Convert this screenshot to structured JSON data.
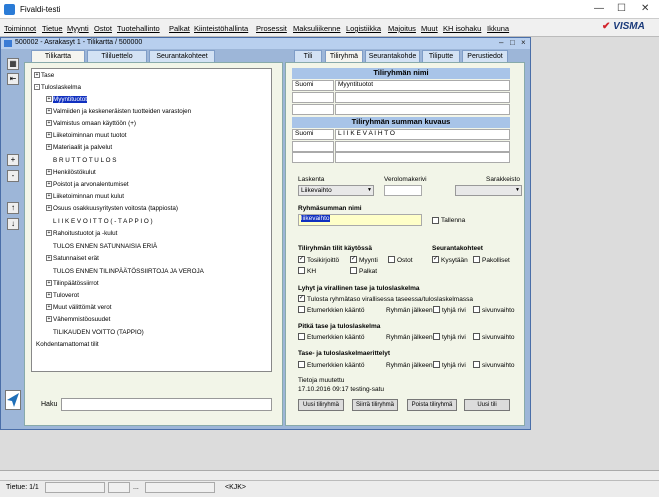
{
  "window": {
    "title": "Fivaldi-testi"
  },
  "menu": {
    "items": [
      "Toiminnot",
      "Tietue",
      "Myynti",
      "Ostot",
      "Tuotehallinto",
      "Palkat",
      "Kiinteistöhallinta",
      "Prosessit",
      "Maksuliikenne",
      "Logistiikka",
      "Majoitus",
      "Muut",
      "KH isohaku",
      "Ikkuna"
    ]
  },
  "brand": {
    "logo": "VISMA"
  },
  "inner": {
    "title": "500002 - Asrakasyt 1 - Tilikartta / 500000"
  },
  "left_tabs": [
    "Tilikartta",
    "Tililuettelo",
    "Seurantakohteet"
  ],
  "right_tabs": [
    "Tili",
    "Tiliryhmä",
    "Seurantakohde",
    "Tiliputte",
    "Perustiedot"
  ],
  "tree": {
    "nodes": [
      {
        "label": "Tase"
      },
      {
        "label": "Tuloslaskelma"
      },
      {
        "label": "Myyntituotot"
      },
      {
        "label": "Valmiiden ja keskeneräisten tuotteiden varastojen"
      },
      {
        "label": "Valmistus omaan käyttöön (+)"
      },
      {
        "label": "Liiketoiminnan muut tuotot"
      },
      {
        "label": "Materiaalit ja palvelut"
      },
      {
        "label": "B R U T T O T U L O S"
      },
      {
        "label": "Henkilöstökulut"
      },
      {
        "label": "Poistot ja arvonalentumiset"
      },
      {
        "label": "Liiketoiminnan muut kulut"
      },
      {
        "label": "Osuus osakkuusyritysten voitosta (tappiosta)"
      },
      {
        "label": "L I I K E V O I T T O  ( - T A P P I O )"
      },
      {
        "label": "Rahoitustuotot ja -kulut"
      },
      {
        "label": "TULOS ENNEN SATUNNAISIA ERIÄ"
      },
      {
        "label": "Satunnaiset erät"
      },
      {
        "label": "TULOS ENNEN TILINPÄÄTÖSSIIRTOJA  JA VEROJA"
      },
      {
        "label": "Tilinpäätössiirrot"
      },
      {
        "label": "Tuloverot"
      },
      {
        "label": "Muut välittömät verot"
      },
      {
        "label": "Vähemmistöosuudet"
      },
      {
        "label": "TILIKAUDEN VOITTO (TAPPIO)"
      },
      {
        "label": "Kohdentamattomat tilit"
      }
    ]
  },
  "search": {
    "label": "Haku",
    "value": ""
  },
  "group_name": {
    "header": "Tiliryhmän nimi",
    "lang": "Suomi",
    "value": "Myyntituotot"
  },
  "group_sum": {
    "header": "Tiliryhmän summan kuvaus",
    "lang": "Suomi",
    "value": "L I I K E V A I H T O"
  },
  "fields": {
    "laskenta_label": "Laskenta",
    "laskenta_value": "Liikevaihto",
    "verolomake_label": "Verolomakerivi",
    "sarakkeisto_label": "Sarakkeisto"
  },
  "ryhmasumma": {
    "label": "Ryhmäsumman nimi",
    "value": "liikevaihto",
    "tallenna": "Tallenna"
  },
  "kaytossa": {
    "header": "Tiliryhmän tilit käytössä",
    "items": [
      {
        "label": "Tosikirjoittö",
        "checked": true
      },
      {
        "label": "Myynti",
        "checked": true
      },
      {
        "label": "Ostot",
        "checked": false
      },
      {
        "label": "KH",
        "checked": false
      },
      {
        "label": "Palkat",
        "checked": false
      }
    ]
  },
  "seuranta": {
    "header": "Seurantakohteet",
    "items": [
      {
        "label": "Kysytään",
        "checked": true
      },
      {
        "label": "Pakolliset",
        "checked": false
      }
    ]
  },
  "lyhyt": {
    "header": "Lyhyt ja virallinen tase ja tuloslaskelma",
    "check1": "Tulosta ryhmätaso virallisessa taseessa/tuloslaskelmassa",
    "check2": "Etumerkkien kääntö",
    "ryhma": "Ryhmän jälkeen",
    "tyhja": "tyhjä rivi",
    "sivu": "sivunvaihto"
  },
  "pitka": {
    "header": "Pitkä tase ja tuloslaskelma",
    "check": "Etumerkkien kääntö",
    "ryhma": "Ryhmän jälkeen",
    "tyhja": "tyhjä rivi",
    "sivu": "sivunvaihto"
  },
  "erittely": {
    "header": "Tase- ja tuloslaskelmaerittelyt",
    "check": "Etumerkkien kääntö",
    "ryhma": "Ryhmän jälkeen",
    "tyhja": "tyhjä rivi",
    "sivu": "sivunvaihto"
  },
  "modified": {
    "label": "Tietoja muutettu",
    "value": "17.10.2016 09:17  testing-satu"
  },
  "buttons": {
    "uusi": "Uusi tiliryhmä",
    "siirra": "Siirrä tiliryhmä",
    "poista": "Poista tiliryhmä",
    "uusi_tili": "Uusi tili"
  },
  "status": {
    "record": "Tietue: 1/1",
    "dots": "...",
    "nav": "<KJK>"
  }
}
